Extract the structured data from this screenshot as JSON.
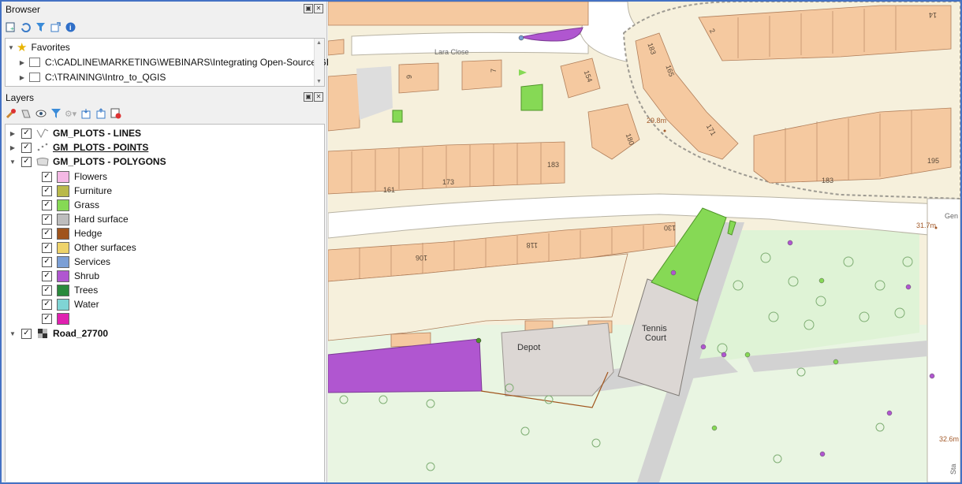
{
  "browser": {
    "title": "Browser",
    "favorites_label": "Favorites",
    "items": [
      "C:\\CADLINE\\MARKETING\\WEBINARS\\Integrating Open-Source GIS",
      "C:\\TRAINING\\Intro_to_QGIS"
    ]
  },
  "layers": {
    "title": "Layers",
    "lines_layer": "GM_PLOTS - LINES",
    "points_layer": "GM_PLOTS - POINTS",
    "polygons_layer": "GM_PLOTS - POLYGONS",
    "categories": [
      {
        "label": "Flowers",
        "color": "#f4b8e4"
      },
      {
        "label": "Furniture",
        "color": "#b9b94a"
      },
      {
        "label": "Grass",
        "color": "#86d955"
      },
      {
        "label": "Hard surface",
        "color": "#bdbdbd"
      },
      {
        "label": "Hedge",
        "color": "#a0541c"
      },
      {
        "label": "Other surfaces",
        "color": "#eed36a"
      },
      {
        "label": "Services",
        "color": "#7b9fd6"
      },
      {
        "label": "Shrub",
        "color": "#b056d0"
      },
      {
        "label": "Trees",
        "color": "#2a8a3c"
      },
      {
        "label": "Water",
        "color": "#7fd4d4"
      },
      {
        "label": "",
        "color": "#e020b0"
      }
    ],
    "road_layer": "Road_27700"
  },
  "map": {
    "street_name": "Lara Close",
    "depot_label": "Depot",
    "tennis_label_1": "Tennis",
    "tennis_label_2": "Court",
    "house_numbers": [
      "183",
      "173",
      "161",
      "130",
      "118",
      "106",
      "183",
      "165",
      "171",
      "183",
      "195",
      "14",
      "2",
      "9",
      "7",
      "154",
      "180"
    ],
    "heights": [
      "29.8m",
      "31.7m",
      "32.6m"
    ],
    "partial_labels": [
      "Gen",
      "Sta"
    ],
    "colors": {
      "background": "#f6f0dc",
      "building": "#f5c9a0",
      "road": "#ffffff",
      "park": "#e6f6de",
      "grass": "#86d955",
      "shrub": "#b056d0"
    }
  }
}
